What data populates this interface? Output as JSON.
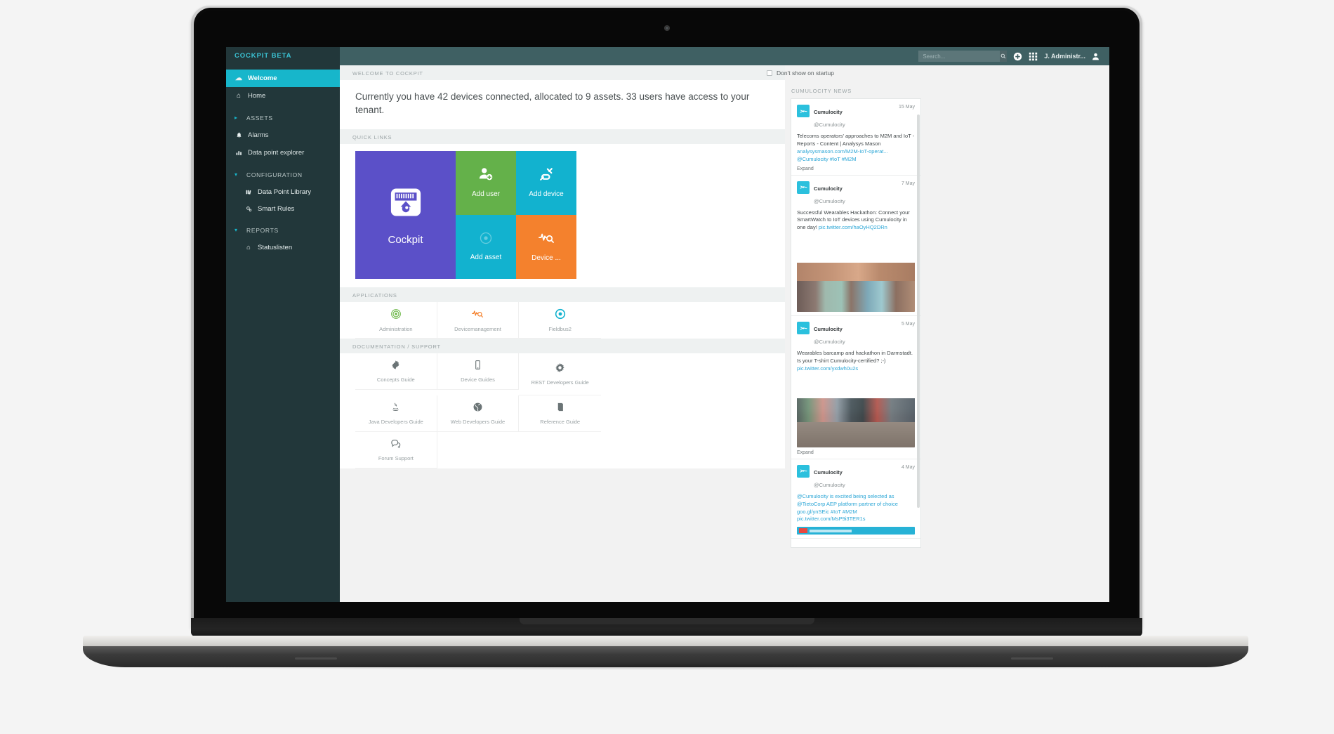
{
  "sidebar": {
    "brand": "COCKPIT BETA",
    "items": [
      {
        "label": "Welcome",
        "icon": "cloud-icon",
        "glyph": "☁",
        "active": true
      },
      {
        "label": "Home",
        "icon": "home-icon",
        "glyph": "⌂",
        "active": false
      },
      {
        "label": "ASSETS",
        "icon": "caret-right-icon",
        "glyph": "▸",
        "group": true
      },
      {
        "label": "Alarms",
        "icon": "bell-icon",
        "glyph": "🔔",
        "active": false
      },
      {
        "label": "Data point explorer",
        "icon": "bar-chart-icon",
        "glyph": "▥",
        "active": false
      }
    ],
    "groups": [
      {
        "label": "CONFIGURATION",
        "icon": "caret-down-icon",
        "glyph": "▾",
        "children": [
          {
            "label": "Data Point Library",
            "icon": "library-icon",
            "glyph": "▤"
          },
          {
            "label": "Smart Rules",
            "icon": "gears-icon",
            "glyph": "⚙"
          }
        ]
      },
      {
        "label": "REPORTS",
        "icon": "caret-down-icon",
        "glyph": "▾",
        "children": [
          {
            "label": "Statuslisten",
            "icon": "home-icon",
            "glyph": "⌂"
          }
        ]
      }
    ]
  },
  "topbar": {
    "search_placeholder": "Search...",
    "search_value": "",
    "search_icon": "search-icon",
    "add_icon": "plus-circle-icon",
    "apps_icon": "app-grid-icon",
    "user_icon": "user-icon",
    "user_label": "J. Administr..."
  },
  "startup": {
    "checkbox_label": "Don't show on startup",
    "checked": false
  },
  "sections": {
    "welcome": "WELCOME TO COCKPIT",
    "quick_links": "QUICK LINKS",
    "applications": "APPLICATIONS",
    "documentation": "DOCUMENTATION / SUPPORT",
    "news": "CUMULOCITY NEWS"
  },
  "welcome": {
    "text": "Currently you have 42 devices connected, allocated to 9 assets. 33 users have access to your tenant.",
    "devices": 42,
    "assets": 9,
    "users": 33
  },
  "tiles": {
    "main": {
      "label": "Cockpit",
      "icon": "gauge-icon",
      "glyph": "⛽",
      "color": "#5b50c8"
    },
    "items": [
      {
        "label": "Add user",
        "icon": "user-plus-icon",
        "glyph": "👤",
        "color": "#64b14a"
      },
      {
        "label": "Add device",
        "icon": "plug-icon",
        "glyph": "🔌",
        "color": "#12b2cf"
      },
      {
        "label": "Add asset",
        "icon": "asset-icon",
        "glyph": "◉",
        "color": "#12b2cf"
      },
      {
        "label": "Device ...",
        "icon": "device-search-icon",
        "glyph": "⌕",
        "color": "#f4812d"
      }
    ]
  },
  "applications": [
    {
      "label": "Administration",
      "icon": "target-icon",
      "glyph": "◎",
      "color": "#6eb94a"
    },
    {
      "label": "Devicemanagement",
      "icon": "device-search-icon",
      "glyph": "⌕",
      "color": "#f4812d"
    },
    {
      "label": "Fieldbus2",
      "icon": "circle-dot-icon",
      "glyph": "◉",
      "color": "#12b2cf"
    }
  ],
  "documentation": [
    {
      "label": "Concepts Guide",
      "icon": "cog-icon",
      "glyph": "⚙"
    },
    {
      "label": "Device Guides",
      "icon": "mobile-icon",
      "glyph": "⎕"
    },
    {
      "label": "REST Developers Guide",
      "icon": "gear-icon",
      "glyph": "⚙"
    },
    {
      "label": "Java Developers Guide",
      "icon": "java-icon",
      "glyph": "♨"
    },
    {
      "label": "Web Developers Guide",
      "icon": "globe-icon",
      "glyph": "🌐"
    },
    {
      "label": "Reference Guide",
      "icon": "book-icon",
      "glyph": "▮"
    },
    {
      "label": "Forum Support",
      "icon": "comments-icon",
      "glyph": "💬"
    }
  ],
  "news": {
    "tweets": [
      {
        "name": "Cumulocity",
        "handle": "@Cumulocity",
        "date": "15 May",
        "body": "Telecoms operators' approaches to M2M and IoT - Reports - Content | Analysys Mason",
        "link": "analysysmason.com/M2M-IoT-operat...",
        "tags": "@Cumulocity #IoT #M2M",
        "expand": "Expand",
        "photo": null
      },
      {
        "name": "Cumulocity",
        "handle": "@Cumulocity",
        "date": "7 May",
        "body": "Successful Wearables Hackathon: Connect your SmartWatch to IoT devices using Cumulocity in one day!",
        "link": "pic.twitter.com/haOyHQ2DRn",
        "tags": "",
        "expand": "",
        "photo": "hackathon-room"
      },
      {
        "name": "Cumulocity",
        "handle": "@Cumulocity",
        "date": "5 May",
        "body": "Wearables barcamp and hackathon in Darmstadt. Is your T-shirt Cumulocity-certified? ;-)",
        "link": "pic.twitter.com/yxdwh0u2s",
        "tags": "",
        "expand": "Expand",
        "photo": "barcamp-crowd"
      },
      {
        "name": "Cumulocity",
        "handle": "@Cumulocity",
        "date": "4 May",
        "body": "@Cumulocity is excited being selected as @TietoCorp AEP platform partner of choice goo.gl/ynSEic #IoT #M2M",
        "link": "pic.twitter.com/MsP9i3TER1s",
        "tags": "",
        "expand": "",
        "photo": "banner"
      }
    ]
  },
  "colors": {
    "sidebar_bg": "#22373a",
    "sidebar_active": "#17b6cb",
    "topbar_bg": "#3f6063",
    "brand_text": "#3bc3d4",
    "tile_purple": "#5b50c8",
    "tile_green": "#64b14a",
    "tile_cyan": "#12b2cf",
    "tile_orange": "#f4812d",
    "workspace_bg": "#f2f2f2"
  }
}
